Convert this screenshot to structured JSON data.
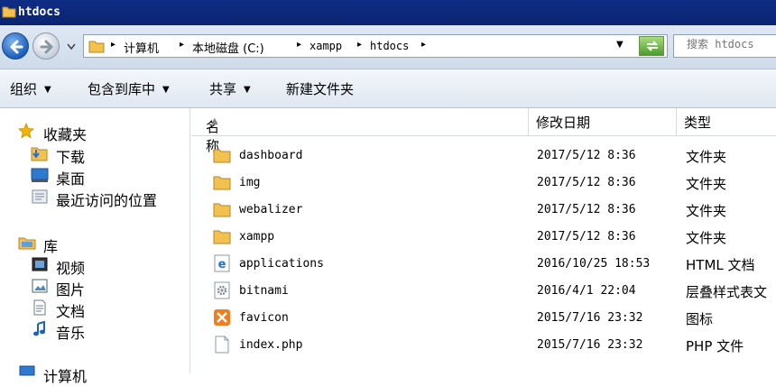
{
  "window": {
    "title": "htdocs"
  },
  "address": {
    "crumbs": [
      "计算机",
      "本地磁盘 (C:)",
      "xampp",
      "htdocs"
    ]
  },
  "search": {
    "placeholder": "搜索 htdocs"
  },
  "toolbar": {
    "organize": "组织",
    "include_in_library": "包含到库中",
    "share": "共享",
    "new_folder": "新建文件夹"
  },
  "sidebar": {
    "favorites_label": "收藏夹",
    "favorites": [
      {
        "label": "下载",
        "icon": "download-folder-icon"
      },
      {
        "label": "桌面",
        "icon": "desktop-icon"
      },
      {
        "label": "最近访问的位置",
        "icon": "recent-places-icon"
      }
    ],
    "libraries_label": "库",
    "libraries": [
      {
        "label": "视频",
        "icon": "video-library-icon"
      },
      {
        "label": "图片",
        "icon": "picture-library-icon"
      },
      {
        "label": "文档",
        "icon": "document-library-icon"
      },
      {
        "label": "音乐",
        "icon": "music-library-icon"
      }
    ],
    "computer_label": "计算机"
  },
  "columns": {
    "name": "名称",
    "modified": "修改日期",
    "type": "类型"
  },
  "files": [
    {
      "name": "dashboard",
      "modified": "2017/5/12 8:36",
      "type": "文件夹",
      "icon": "folder-icon"
    },
    {
      "name": "img",
      "modified": "2017/5/12 8:36",
      "type": "文件夹",
      "icon": "folder-icon"
    },
    {
      "name": "webalizer",
      "modified": "2017/5/12 8:36",
      "type": "文件夹",
      "icon": "folder-icon"
    },
    {
      "name": "xampp",
      "modified": "2017/5/12 8:36",
      "type": "文件夹",
      "icon": "folder-icon"
    },
    {
      "name": "applications",
      "modified": "2016/10/25 18:53",
      "type": "HTML 文档",
      "icon": "ie-html-icon"
    },
    {
      "name": "bitnami",
      "modified": "2016/4/1 22:04",
      "type": "层叠样式表文",
      "icon": "css-gear-icon"
    },
    {
      "name": "favicon",
      "modified": "2015/7/16 23:32",
      "type": "图标",
      "icon": "xampp-icon"
    },
    {
      "name": "index.php",
      "modified": "2015/7/16 23:32",
      "type": "PHP 文件",
      "icon": "file-icon"
    }
  ]
}
